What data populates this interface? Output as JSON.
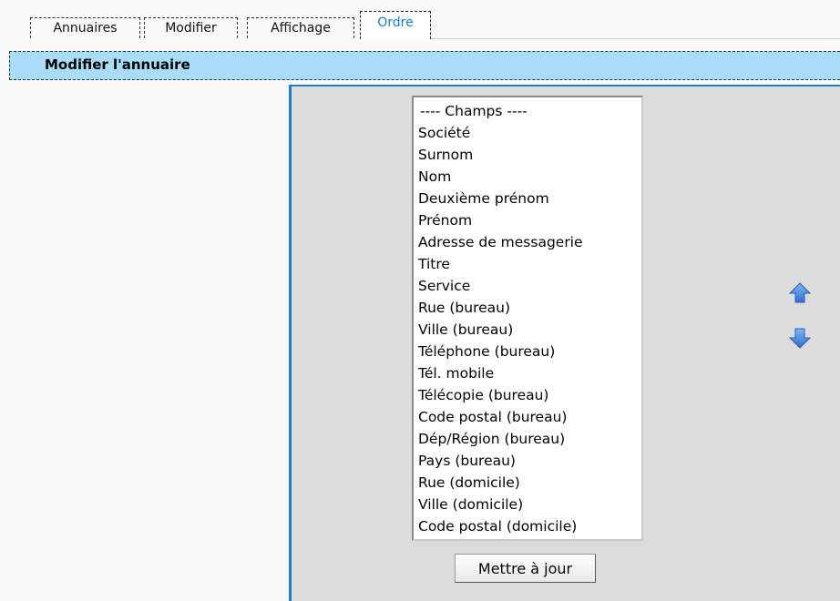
{
  "tabs": [
    {
      "label": "Annuaires",
      "active": false
    },
    {
      "label": "Modifier",
      "active": false
    },
    {
      "label": "Affichage",
      "active": false
    },
    {
      "label": "Ordre",
      "active": true
    }
  ],
  "header": {
    "title": "Modifier l'annuaire"
  },
  "fields_list": {
    "header": "---- Champs ----",
    "items": [
      "Société",
      "Surnom",
      "Nom",
      "Deuxième prénom",
      "Prénom",
      "Adresse de messagerie",
      "Titre",
      "Service",
      "Rue (bureau)",
      "Ville (bureau)",
      "Téléphone (bureau)",
      "Tél. mobile",
      "Télécopie (bureau)",
      "Code postal (bureau)",
      "Dép/Région (bureau)",
      "Pays (bureau)",
      "Rue (domicile)",
      "Ville (domicile)",
      "Code postal (domicile)"
    ]
  },
  "controls": {
    "move_up_icon": "arrow-up-icon",
    "move_down_icon": "arrow-down-icon",
    "update_label": "Mettre à jour"
  },
  "colors": {
    "accent": "#1a7fc3",
    "header_bg": "#a9dcf7",
    "panel_bg": "#dcdcdc"
  }
}
